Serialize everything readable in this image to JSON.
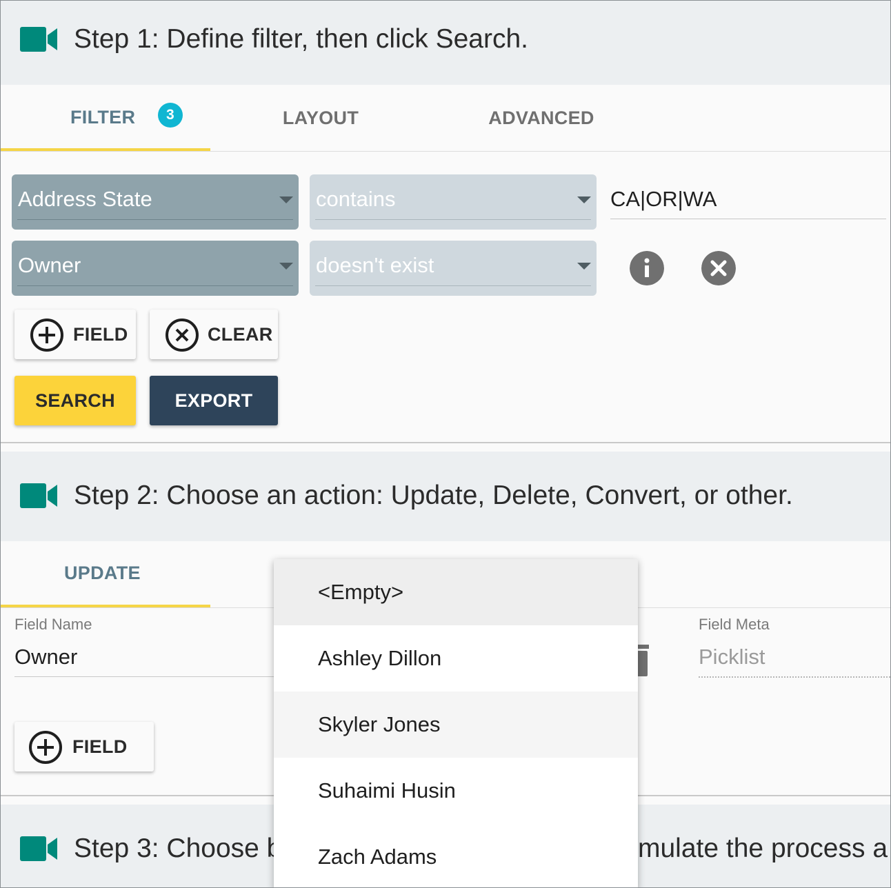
{
  "step1": {
    "title": "Step 1: Define filter, then click Search.",
    "tabs": [
      {
        "label": "FILTER",
        "badge": "3",
        "active": true
      },
      {
        "label": "LAYOUT",
        "active": false
      },
      {
        "label": "ADVANCED",
        "active": false
      }
    ],
    "rows": [
      {
        "field": "Address State",
        "operator": "contains",
        "value": "CA|OR|WA"
      },
      {
        "field": "Owner",
        "operator": "doesn't exist"
      }
    ],
    "buttons": {
      "add_field": "FIELD",
      "clear": "CLEAR",
      "search": "SEARCH",
      "export": "EXPORT"
    }
  },
  "step2": {
    "title": "Step 2: Choose an action: Update, Delete, Convert, or other.",
    "tab": "UPDATE",
    "field_name_label": "Field Name",
    "field_name_value": "Owner",
    "field_meta_label": "Field Meta",
    "field_meta_value": "Picklist",
    "add_field": "FIELD"
  },
  "step3": {
    "title_left": "Step 3: Choose b",
    "title_right": "mulate the process a"
  },
  "dropdown": {
    "options": [
      "<Empty>",
      "Ashley Dillon",
      "Skyler Jones",
      "Suhaimi Husin",
      "Zach Adams"
    ]
  },
  "colors": {
    "accent_teal": "#00897b",
    "tab_underline": "#f5d547",
    "badge": "#10b6d2",
    "search_button": "#fcd33a",
    "export_button": "#2e445a"
  }
}
